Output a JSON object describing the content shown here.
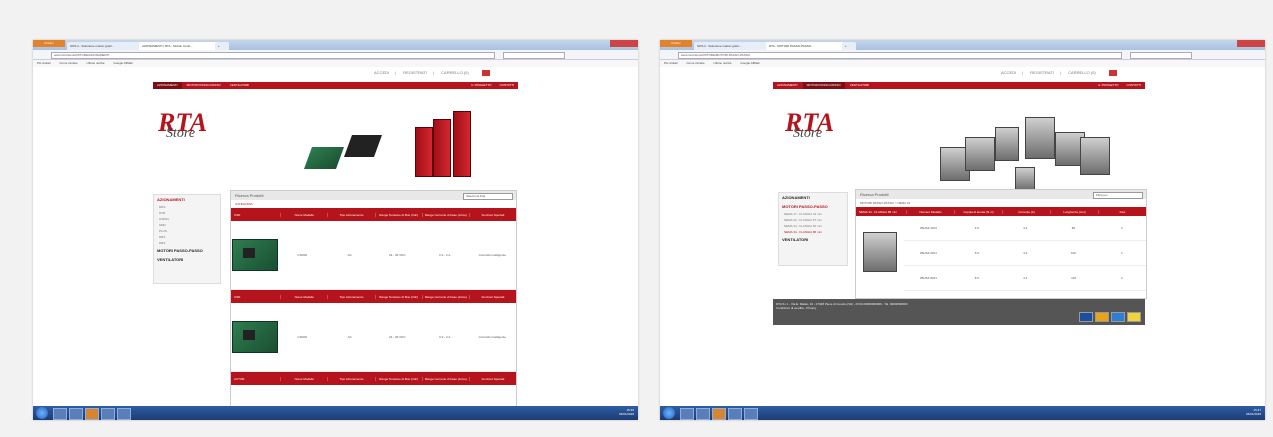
{
  "left": {
    "browser": {
      "tabs": [
        "Firefox",
        "SOS.it - Soluzione motion grazi...",
        "AZIONAMENTI | RTA - Motion Contr...",
        "+"
      ],
      "url": "www.rta.it/store/it/STORE/AZIONAMENTI",
      "bookmarks": [
        "Più visitati",
        "Come iniziare",
        "Ultime notizie",
        "Google Affiliati"
      ]
    },
    "toplinks": [
      "ACCEDI",
      "REGISTRATI",
      "CARRELLO (0)"
    ],
    "nav": [
      "AZIONAMENTI",
      "MOTORI PASSO-PASSO",
      "VENTILATORI"
    ],
    "nav_right": [
      "IL PROGETTO",
      "CONTATTI"
    ],
    "logo": {
      "abbr": "RTA",
      "word": "Store"
    },
    "sidebar": {
      "heading": "AZIONAMENTI",
      "items": [
        "DRS",
        "HTB",
        "CSD94",
        "SMD",
        "PLUS",
        "DRS",
        "DRS"
      ],
      "sections": [
        "MOTORI PASSO-PASSO",
        "VENTILATORI"
      ]
    },
    "panel": {
      "title": "Ricerca Prodotti",
      "select": "Seleziona lista",
      "crumb": "CATEGORIA",
      "columns": [
        "Nome Modello",
        "Tipo Azionamento",
        "Range Tensione di Bus (Vdc)",
        "Range Corrente di Fase (Arms)",
        "Funzioni Speciali"
      ],
      "rows": [
        {
          "cat": "CSD",
          "model": "CSD02",
          "type": "AC",
          "vbus": "24 - 36 VDC",
          "curr": "0,3 - 2 A",
          "feat": "Controllo Intelligente"
        },
        {
          "cat": "CSD",
          "model": "CSD02",
          "type": "AC",
          "vbus": "24 - 36 VDC",
          "curr": "0,3 - 2 A",
          "feat": "Controllo Intelligente"
        },
        {
          "cat": "ACTOR",
          "model": "",
          "type": "",
          "vbus": "",
          "curr": "",
          "feat": ""
        }
      ]
    },
    "taskbar": {
      "time": "15:46",
      "date": "26/01/2018"
    }
  },
  "right": {
    "browser": {
      "tabs": [
        "Firefox",
        "SOS.it - Soluzione motion grazi...",
        "RTA - MOTORI PASSO-PASSO...",
        "+"
      ],
      "url": "www.rta.it/store/it/STORE/MOTORI-PASSO-PASSO",
      "bookmarks": [
        "Più visitati",
        "Come iniziare",
        "Ultime notizie",
        "Google Affiliati"
      ]
    },
    "toplinks": [
      "ACCEDI",
      "REGISTRATI",
      "CARRELLO (0)"
    ],
    "nav": [
      "AZIONAMENTI",
      "MOTORI PASSO-PASSO",
      "VENTILATORI"
    ],
    "nav_right": [
      "IL PROGETTO",
      "CONTATTI"
    ],
    "logo": {
      "abbr": "RTA",
      "word": "Store"
    },
    "sidebar": {
      "sections": [
        "AZIONAMENTI",
        "MOTORI PASSO-PASSO",
        "VENTILATORI"
      ],
      "items": [
        "NEMA 17 - FLANGIA 42 mm",
        "NEMA 23 - FLANGIA 57 mm",
        "NEMA 24 - FLANGIA 60 mm",
        "NEMA 34 - FLANGIA 86 mm"
      ]
    },
    "panel": {
      "title": "Ricerca Prodotti",
      "select": "Filtra per",
      "crumb": "MOTORI PASSO-PASSO > NEMA 34",
      "columns": [
        "NEMA 34 - FLANGIA 86 mm",
        "Numero Modello",
        "Coppia di tenuta (N·m)",
        "Corrente (A)",
        "Lunghezza (mm)",
        "Fasi"
      ],
      "rows": [
        {
          "model": "86HS4-4201",
          "torque": "4.5",
          "curr": "4.2",
          "len": "80",
          "ph": "2"
        },
        {
          "model": "86HS4-6201",
          "torque": "6.5",
          "curr": "4.2",
          "len": "100",
          "ph": "2"
        },
        {
          "model": "86HS4-8201",
          "torque": "8.5",
          "curr": "4.2",
          "len": "118",
          "ph": "2"
        }
      ]
    },
    "footer": "RTA S.r.l. - Via E. Mattei, 10 - 27028 Pieve di Cusolio (VA) - P.IVA 00000000000 - Tel. 0000/000000",
    "footer2": "Condizioni di vendita - Privacy",
    "taskbar": {
      "time": "15:47",
      "date": "26/01/2018"
    }
  }
}
